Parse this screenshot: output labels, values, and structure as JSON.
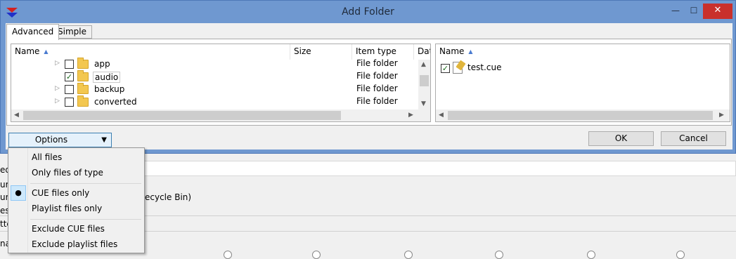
{
  "dialog": {
    "title": "Add Folder",
    "window_buttons": {
      "minimize": "—",
      "maximize": "☐",
      "close": "✕"
    }
  },
  "tabs": [
    {
      "label": "Advanced",
      "active": true
    },
    {
      "label": "Simple",
      "active": false
    }
  ],
  "folder_tree": {
    "columns": [
      "Name",
      "Size",
      "Item type",
      "Dat"
    ],
    "rows": [
      {
        "name": "app",
        "checked": false,
        "type": "File folder"
      },
      {
        "name": "audio",
        "checked": true,
        "type": "File folder",
        "selected": true
      },
      {
        "name": "backup",
        "checked": false,
        "type": "File folder"
      },
      {
        "name": "converted",
        "checked": false,
        "type": "File folder"
      }
    ]
  },
  "file_list": {
    "column": "Name",
    "items": [
      {
        "name": "test.cue",
        "checked": true
      }
    ]
  },
  "buttons": {
    "options": "Options",
    "ok": "OK",
    "cancel": "Cancel"
  },
  "options_menu": {
    "items": [
      "All files",
      "Only files of type",
      "CUE files only",
      "Playlist files only",
      "Exclude CUE files",
      "Exclude playlist files"
    ],
    "selected": "CUE files only"
  },
  "background": {
    "fragments": [
      "ed",
      "urc",
      "ur",
      "es",
      "tte",
      "na",
      "ecycle Bin)"
    ]
  },
  "colors": {
    "title_bar": "#6f98d0",
    "close_button": "#c9302c",
    "selection": "#cde8fb",
    "check": "#1a6b1a",
    "folder": "#f3c74f"
  }
}
